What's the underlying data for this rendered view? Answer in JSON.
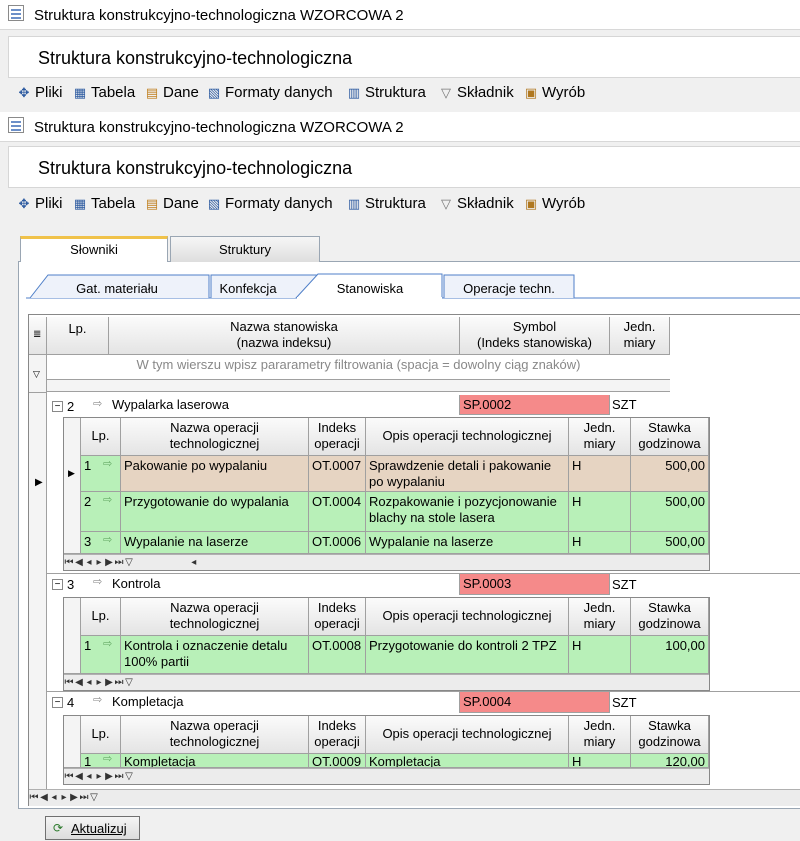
{
  "window_title": "Struktura konstrukcyjno-technologiczna WZORCOWA 2",
  "page_heading": "Struktura konstrukcyjno-technologiczna",
  "menu": [
    "Pliki",
    "Tabela",
    "Dane",
    "Formaty danych",
    "Struktura",
    "Składnik",
    "Wyrób"
  ],
  "top_tabs": [
    "Słowniki",
    "Struktury"
  ],
  "sub_tabs": [
    "Gat. materiału",
    "Konfekcja",
    "Stanowiska",
    "Operacje techn."
  ],
  "main_grid": {
    "headers": {
      "lp": "Lp.",
      "name": "Nazwa stanowiska\n(nazwa indeksu)",
      "symbol": "Symbol\n(Indeks stanowiska)",
      "unit": "Jedn.\nmiary"
    },
    "filter_hint": "W tym wierszu wpisz pararametry filtrowania (spacja = dowolny ciąg znaków)"
  },
  "sub_headers": {
    "lp": "Lp.",
    "name": "Nazwa operacji\ntechnologicznej",
    "index": "Indeks\noperacji",
    "desc": "Opis operacji technologicznej",
    "unit": "Jedn.\nmiary",
    "rate": "Stawka\ngodzinowa"
  },
  "stations": [
    {
      "lp": "2",
      "name": "Wypalarka laserowa",
      "symbol": "SP.0002",
      "unit": "SZT",
      "operations": [
        {
          "lp": "1",
          "name": "Pakowanie po wypalaniu",
          "index": "OT.0007",
          "desc": "Sprawdzenie detali i pakowanie po wypalaniu",
          "unit": "H",
          "rate": "500,00"
        },
        {
          "lp": "2",
          "name": "Przygotowanie do wypalania",
          "index": "OT.0004",
          "desc": "Rozpakowanie i pozycjonowanie blachy na stole lasera",
          "unit": "H",
          "rate": "500,00"
        },
        {
          "lp": "3",
          "name": "Wypalanie na laserze",
          "index": "OT.0006",
          "desc": "Wypalanie na laserze",
          "unit": "H",
          "rate": "500,00"
        }
      ]
    },
    {
      "lp": "3",
      "name": "Kontrola",
      "symbol": "SP.0003",
      "unit": "SZT",
      "operations": [
        {
          "lp": "1",
          "name": "Kontrola i oznaczenie detalu 100% partii",
          "index": "OT.0008",
          "desc": "Przygotowanie do kontroli 2 TPZ",
          "unit": "H",
          "rate": "100,00"
        }
      ]
    },
    {
      "lp": "4",
      "name": "Kompletacja",
      "symbol": "SP.0004",
      "unit": "SZT",
      "operations": [
        {
          "lp": "1",
          "name": "Kompletacja",
          "index": "OT.0009",
          "desc": "Kompletacja",
          "unit": "H",
          "rate": "120,00"
        }
      ]
    }
  ],
  "refresh_button": "Aktualizuj",
  "colors": {
    "green": "#b8f0b8",
    "selected": "#e6d4c2",
    "symbol": "#f58a8a",
    "tab_accent": "#f0c24a"
  }
}
